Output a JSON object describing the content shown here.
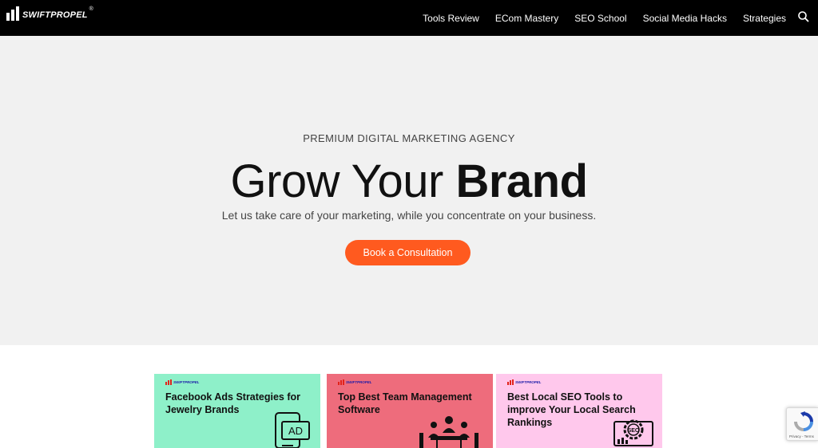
{
  "header": {
    "logo_text": "SWIFTPROPEL",
    "logo_registered": "®",
    "nav": [
      {
        "label": "Tools Review"
      },
      {
        "label": "ECom Mastery"
      },
      {
        "label": "SEO School"
      },
      {
        "label": "Social Media Hacks"
      },
      {
        "label": "Strategies"
      }
    ],
    "search_icon": "search-icon"
  },
  "hero": {
    "eyebrow": "PREMIUM DIGITAL MARKETING AGENCY",
    "headline_light": "Grow Your ",
    "headline_bold": "Brand",
    "subtitle": "Let us take care of your marketing, while you concentrate on your business.",
    "cta_label": "Book a Consultation",
    "background": "#f1f1f1",
    "cta_color": "#ff5a1f"
  },
  "posts": [
    {
      "brand": "SWIFTPROPEL",
      "title": "Facebook Ads Strategies for Jewelry Brands",
      "bg": "#8ef0c9",
      "icon": "ad-phone-icon",
      "art_text": "AD"
    },
    {
      "brand": "SWIFTPROPEL",
      "title": "Top Best Team Management Software",
      "bg": "#ee6c7c",
      "icon": "team-meeting-icon"
    },
    {
      "brand": "SWIFTPROPEL",
      "title": "Best Local SEO Tools to improve Your Local Search Rankings",
      "bg": "#ffc8ec",
      "icon": "seo-gear-icon",
      "art_text": "SEO"
    }
  ],
  "recaptcha": {
    "footer": "Privacy - Terms",
    "icon": "recaptcha-icon"
  }
}
